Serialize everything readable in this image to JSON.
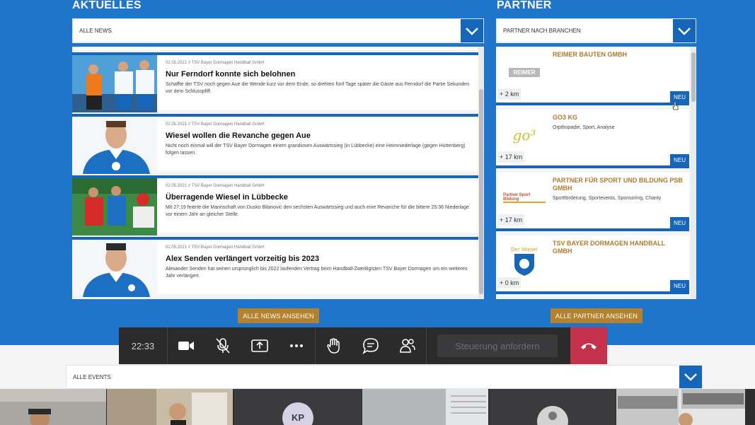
{
  "sections": {
    "news_title": "AKTUELLES",
    "partner_title": "PARTNER"
  },
  "news_filter": {
    "selected": "ALLE NEWS"
  },
  "partner_filter": {
    "selected": "PARTNER NACH BRANCHEN"
  },
  "news": [
    {
      "date": "02.05.2021 // TSV Bayer Dormagen Handball GmbH",
      "title": "Nur Ferndorf konnte sich belohnen",
      "text": "Schaffte der TSV noch gegen Aue die Wende kurz vor dem Ende, so drehten fünf Tage später die Gäste aus Ferndorf die Partie Sekunden vor dem Schlusspfiff."
    },
    {
      "date": "02.05.2021 // TSV Bayer Dormagen Handball GmbH",
      "title": "Wiesel wollen die Revanche gegen Aue",
      "text": "Nicht noch einmal will der TSV Bayer Dormagen einem grandiosen Auswärtssieg (in Lübbecke) eine Heimniederlage (gegen Hüttenberg) folgen lassen."
    },
    {
      "date": "02.05.2021 // TSV Bayer Dormagen Handball GmbH",
      "title": "Überragende Wiesel in Lübbecke",
      "text": "Mit 27:19 feierte die Mannschaft von Dusko Bilanovic den sechsten Auswärtssieg und auch eine Revanche für die bittere 25:36 Niederlage vor einem Jahr an gleicher Stelle."
    },
    {
      "date": "02.05.2021 // TSV Bayer Dormagen Handball GmbH",
      "title": "Alex Senden verlängert vorzeitig bis 2023",
      "text": "Alexander Senden hat seinen ursprünglich bis 2022 laufenden Vertrag beim Handball-Zweitligisten TSV Bayer Dormagen um ein weiteres Jahr verlängert."
    }
  ],
  "partners": [
    {
      "name": "REIMER BAUTEN GMBH",
      "desc": "",
      "dist": "+ 2 km",
      "badge": "NEU",
      "logo_text": "REIMER"
    },
    {
      "name": "GO3 KG",
      "desc": "Orpthopadie, Sport, Analyse",
      "dist": "+ 17 km",
      "badge": "NEU",
      "logo_text": "go³"
    },
    {
      "name": "PARTNER FÜR SPORT UND BILDUNG PSB GMBH",
      "desc": "Sportförderung, Sportevents, Sponsoring, Charity",
      "dist": "+ 17 km",
      "badge": "NEU",
      "logo_text": "Partner Sport Bildung"
    },
    {
      "name": "TSV BAYER DORMAGEN HANDBALL GMBH",
      "desc": "",
      "dist": "+ 0 km",
      "badge": "NEU",
      "logo_text": "Der Wiesel"
    }
  ],
  "buttons": {
    "all_news": "ALLE NEWS ANSEHEN",
    "all_partners": "ALLE PARTNER ANSEHEN"
  },
  "events_filter": {
    "selected": "ALLE EVENTS"
  },
  "meeting": {
    "time": "22:33",
    "request_control": "Steuerung anfordern",
    "icons": [
      "camera-icon",
      "mic-off-icon",
      "share-screen-icon",
      "more-icon",
      "raise-hand-icon",
      "chat-icon",
      "participants-icon",
      "hang-up-icon"
    ]
  },
  "participants": [
    {
      "initials": "KP"
    }
  ],
  "colors": {
    "brand_blue": "#1f75c9",
    "dark_blue": "#1565b8",
    "gold": "#b4812c",
    "hangup_red": "#c4314b",
    "toolbar": "#2b2b2c"
  }
}
